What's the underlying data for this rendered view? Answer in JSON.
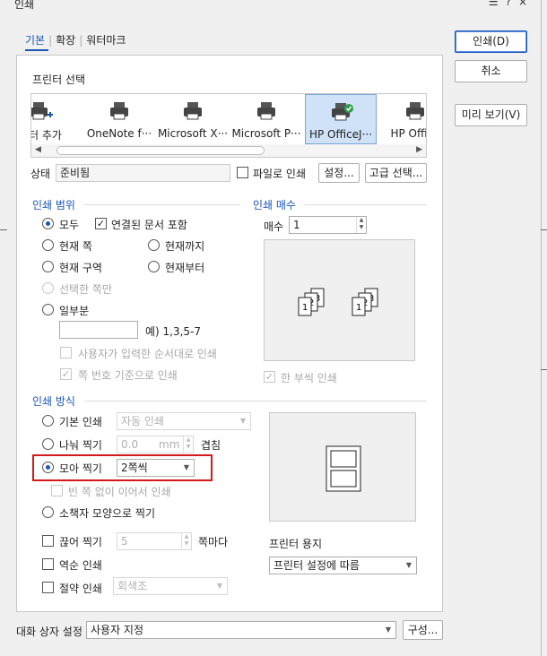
{
  "window": {
    "title": "인쇄"
  },
  "tabs": [
    {
      "label": "기본"
    },
    {
      "label": "확장"
    },
    {
      "label": "워터마크"
    }
  ],
  "buttons": {
    "print": "인쇄(D)",
    "cancel": "취소",
    "preview": "미리 보기(V)",
    "settings": "설정...",
    "advanced": "고급 선택...",
    "configure": "구성..."
  },
  "printer_select": {
    "label": "프린터 선택",
    "printers": [
      {
        "name": "린터 추가"
      },
      {
        "name": "OneNote f···"
      },
      {
        "name": "Microsoft X···"
      },
      {
        "name": "Microsoft P···"
      },
      {
        "name": "HP OfficeJ···"
      },
      {
        "name": "HP Office"
      }
    ]
  },
  "status": {
    "label": "상태",
    "value": "준비됨",
    "to_file": "파일로 인쇄"
  },
  "print_range": {
    "title": "인쇄 범위",
    "all": "모두",
    "include_linked": "연결된 문서 포함",
    "current_page": "현재 쪽",
    "up_to_current": "현재까지",
    "current_section": "현재 구역",
    "from_current": "현재부터",
    "selection": "선택한 쪽만",
    "partial": "일부분",
    "example": "예) 1,3,5-7",
    "user_order": "사용자가 입력한 순서대로 인쇄",
    "page_number_basis": "쪽 번호 기준으로 인쇄"
  },
  "copies": {
    "title": "인쇄 매수",
    "label": "매수",
    "value": "1",
    "collate": "한 부씩 인쇄"
  },
  "print_method": {
    "title": "인쇄 방식",
    "basic": "기본 인쇄",
    "basic_option": "자동 인쇄",
    "split": "나눠 찍기",
    "split_value": "0.0",
    "split_unit": "mm",
    "overlap": "겹침",
    "nup": "모아 찍기",
    "nup_option": "2쪽씩",
    "no_blank": "빈 쪽 없이 이어서 인쇄",
    "booklet": "소책자 모양으로 찍기"
  },
  "options": {
    "break": "끊어 찍기",
    "break_value": "5",
    "per_page": "쪽마다",
    "reverse": "역순 인쇄",
    "saving": "절약 인쇄",
    "saving_option": "회색조"
  },
  "paper": {
    "label": "프린터 용지",
    "value": "프린터 설정에 따름"
  },
  "dialog_settings": {
    "label": "대화 상자 설정",
    "value": "사용자 지정"
  },
  "colors": {
    "accent": "#1a55b8",
    "highlight": "#d11a1a",
    "selected": "#cfe2f7"
  }
}
